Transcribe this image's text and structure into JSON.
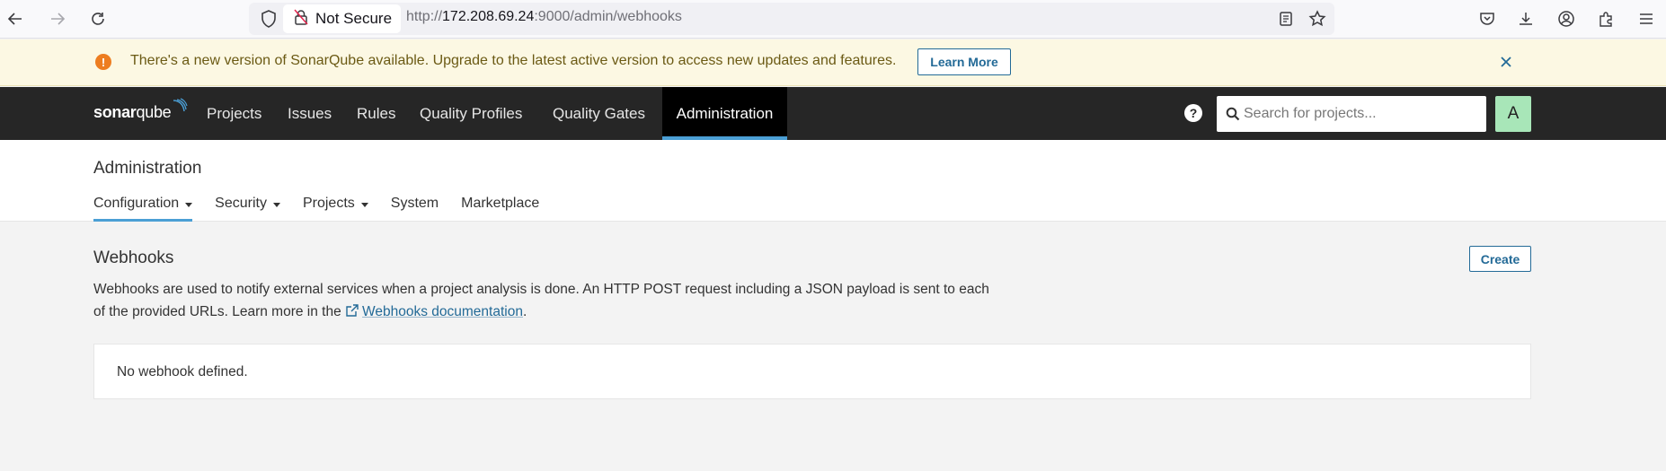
{
  "browser": {
    "not_secure_label": "Not Secure",
    "url_prefix": "http://",
    "url_host": "172.208.69.24",
    "url_rest": ":9000/admin/webhooks",
    "icons": [
      "back-icon",
      "forward-icon",
      "reload-icon",
      "shield-icon",
      "insecure-lock-icon",
      "reader-icon",
      "bookmark-star-icon",
      "pocket-icon",
      "download-icon",
      "account-icon",
      "extensions-icon",
      "menu-icon"
    ]
  },
  "banner": {
    "message": "There's a new version of SonarQube available. Upgrade to the latest active version to access new updates and features.",
    "learn_more_label": "Learn More",
    "icon": "warning-icon",
    "close_icon": "close-icon"
  },
  "navbar": {
    "logo_bold": "sonar",
    "logo_rest": "qube",
    "items": [
      {
        "label": "Projects"
      },
      {
        "label": "Issues"
      },
      {
        "label": "Rules"
      },
      {
        "label": "Quality Profiles"
      },
      {
        "label": "Quality Gates"
      },
      {
        "label": "Administration",
        "active": true
      }
    ],
    "search_placeholder": "Search for projects...",
    "avatar_letter": "A"
  },
  "admin": {
    "title": "Administration",
    "tabs": [
      {
        "label": "Configuration",
        "dropdown": true,
        "active": true
      },
      {
        "label": "Security",
        "dropdown": true
      },
      {
        "label": "Projects",
        "dropdown": true
      },
      {
        "label": "System"
      },
      {
        "label": "Marketplace"
      }
    ]
  },
  "webhooks": {
    "title": "Webhooks",
    "create_label": "Create",
    "description_before": "Webhooks are used to notify external services when a project analysis is done. An HTTP POST request including a JSON payload is sent to each of the provided URLs. Learn more in the ",
    "doc_link_label": "Webhooks documentation",
    "description_after": ".",
    "empty_message": "No webhook defined."
  },
  "colors": {
    "navbar_bg": "#262626",
    "accent_blue": "#4b9fd5",
    "link_blue": "#236a97",
    "banner_bg": "#fcf8e3",
    "warning_orange": "#ed7d20",
    "avatar_green": "#a8e6b8"
  }
}
